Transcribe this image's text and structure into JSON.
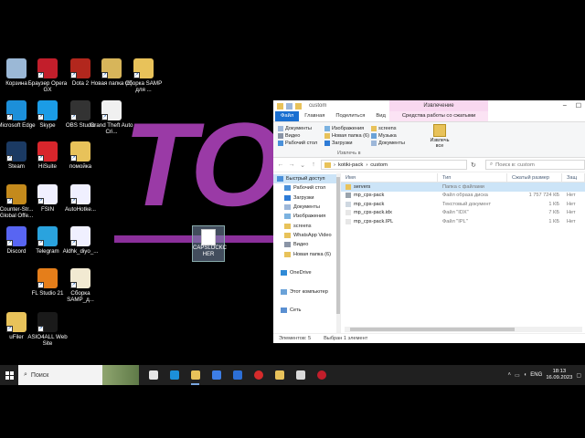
{
  "wallpaper": {
    "text": "TOX"
  },
  "desktop_icons": [
    {
      "label": "Корзина",
      "color": "#9bb8d6"
    },
    {
      "label": "Браузер Opera GX",
      "color": "#c21e2b"
    },
    {
      "label": "Dota 2",
      "color": "#b2271d"
    },
    {
      "label": "Новая папка (6)",
      "color": "#d7b55a"
    },
    {
      "label": "Сборка SAMP для ...",
      "color": "#e8c25a"
    },
    {
      "label": "Microsoft Edge",
      "color": "#1c8fd9"
    },
    {
      "label": "Skype",
      "color": "#1b9ce6"
    },
    {
      "label": "OBS Studio",
      "color": "#333333"
    },
    {
      "label": "Grand Theft Auto Cri...",
      "color": "#f0f0f0"
    },
    {
      "label": "Steam",
      "color": "#1b3a63"
    },
    {
      "label": "HiSuite",
      "color": "#d8262c"
    },
    {
      "label": "помойка",
      "color": "#e8c25a"
    },
    {
      "label": "Counter-Str... Global Offe...",
      "color": "#c48a1c"
    },
    {
      "label": "FSIN",
      "color": "#f0f0ff"
    },
    {
      "label": "AutoHotke...",
      "color": "#f0f0ff"
    },
    {
      "label": "Discord",
      "color": "#5865f2"
    },
    {
      "label": "Telegram",
      "color": "#2aa3de"
    },
    {
      "label": "Aldhk_diyo_...",
      "color": "#f0f0ff"
    },
    {
      "label": "FL Studio 21",
      "color": "#e57e1a"
    },
    {
      "label": "Сборка SAMP_д...",
      "color": "#f2ead2"
    },
    {
      "label": "uFiler",
      "color": "#e8c25a"
    },
    {
      "label": "ASIO4ALL Web Site",
      "color": "#1a1a1a"
    }
  ],
  "dragged_item": {
    "label": "CAPSLOCKCHECKER",
    "display": "CAPSLOCKC HER"
  },
  "explorer": {
    "title": "custom",
    "context_header": "Извлечение",
    "tabs": [
      "Файл",
      "Главная",
      "Поделиться",
      "Вид"
    ],
    "context_tab": "Средства работы со сжатыми папками",
    "ribbon": {
      "col1": [
        "Документы",
        "Видео",
        "Рабочий стол"
      ],
      "col2": [
        "Изображения",
        "Загрузки",
        "Новая папка (6)",
        "Загрузки"
      ],
      "col3": [
        "screens",
        "Музыка",
        "Документы"
      ],
      "group_label": "Извлечь в",
      "extract_all": "Извлечь все"
    },
    "address": {
      "segments": [
        "kotiki-pack",
        "custom"
      ],
      "search_placeholder": "Поиск в: custom"
    },
    "navpane": [
      "Быстрый доступ",
      "Рабочий стол",
      "Загрузки",
      "Документы",
      "Изображения",
      "screens",
      "WhatsApp Video",
      "Видео",
      "Новая папка (6)",
      "",
      "OneDrive",
      "",
      "Этот компьютер",
      "",
      "Сеть"
    ],
    "columns": [
      "Имя",
      "Тип",
      "Сжатый размер",
      "Защ"
    ],
    "files": [
      {
        "name": "servers",
        "type": "Папка с файлами",
        "size": "",
        "prot": "",
        "icon": "folder",
        "color": "#e8c25a"
      },
      {
        "name": "mp_cps-pack",
        "type": "Файл образа диска",
        "size": "1 757 724 КБ",
        "prot": "Нет",
        "icon": "disk",
        "color": "#9aa4ad"
      },
      {
        "name": "mp_cps-pack",
        "type": "Текстовый документ",
        "size": "1 КБ",
        "prot": "Нет",
        "icon": "text",
        "color": "#cfd8e1"
      },
      {
        "name": "mp_cps-pack.idx",
        "type": "Файл \"IDX\"",
        "size": "7 КБ",
        "prot": "Нет",
        "icon": "file",
        "color": "#e7e7e7"
      },
      {
        "name": "mp_cps-pack.IPL",
        "type": "Файл \"IPL\"",
        "size": "1 КБ",
        "prot": "Нет",
        "icon": "file",
        "color": "#e7e7e7"
      }
    ],
    "status": {
      "count": "Элементов: 5",
      "selected": "Выбран 1 элемент"
    }
  },
  "taskbar": {
    "search_label": "Поиск",
    "icons": [
      {
        "name": "task-view",
        "color": "#e6e6e6"
      },
      {
        "name": "edge",
        "color": "#1c8fd9"
      },
      {
        "name": "explorer",
        "color": "#e8c25a"
      },
      {
        "name": "dropbox",
        "color": "#3d7ee6"
      },
      {
        "name": "mail",
        "color": "#2c6fd6"
      },
      {
        "name": "opera",
        "color": "#d62b2b"
      },
      {
        "name": "folder",
        "color": "#e8c25a"
      },
      {
        "name": "pen",
        "color": "#d9d9d9"
      },
      {
        "name": "browser",
        "color": "#c21e2b"
      }
    ],
    "lang": "ENG",
    "time": "18:13",
    "date": "16.09.2023",
    "badge": "2"
  }
}
